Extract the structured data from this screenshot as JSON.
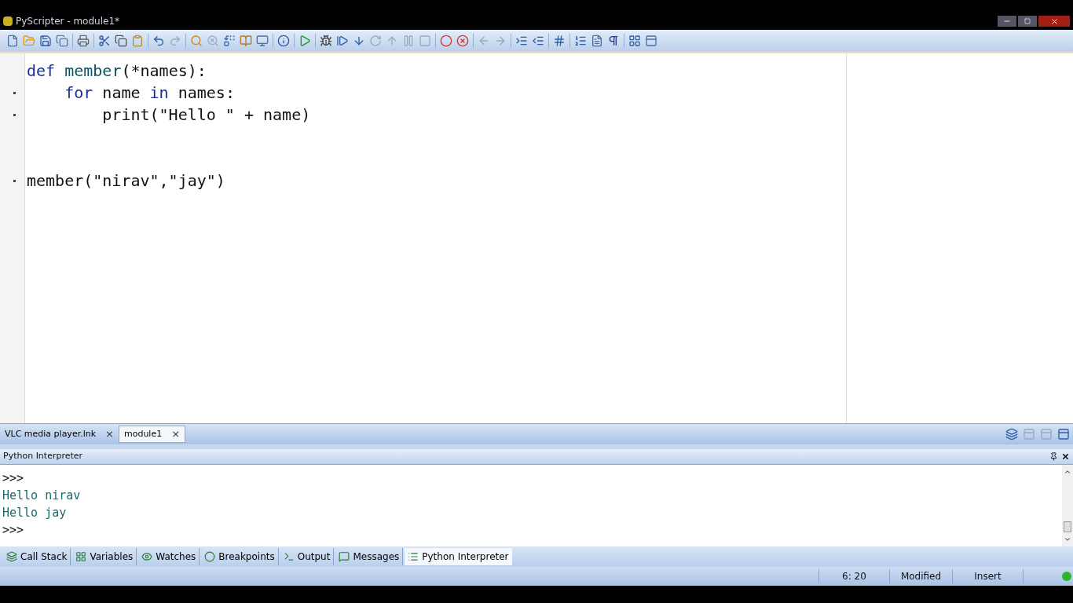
{
  "window": {
    "title": "PyScripter - module1*"
  },
  "editor": {
    "lines": [
      {
        "marker": false,
        "tokens": [
          {
            "kind": "keyword",
            "text": "def "
          },
          {
            "kind": "function",
            "text": "member"
          },
          {
            "kind": "plain",
            "text": "(*names):"
          }
        ]
      },
      {
        "marker": true,
        "tokens": [
          {
            "kind": "keyword",
            "text": "    for"
          },
          {
            "kind": "plain",
            "text": " name "
          },
          {
            "kind": "keyword",
            "text": "in"
          },
          {
            "kind": "plain",
            "text": " names:"
          }
        ]
      },
      {
        "marker": true,
        "tokens": [
          {
            "kind": "plain",
            "text": "        print(\"Hello \" + name)"
          }
        ]
      },
      {
        "marker": false
      },
      {
        "marker": false
      },
      {
        "marker": true,
        "tokens": [
          {
            "kind": "plain",
            "text": "member(\"nirav\",\"jay\")"
          }
        ]
      }
    ]
  },
  "doc_tabs": [
    {
      "label": "VLC media player.lnk",
      "selected": false,
      "close": "×"
    },
    {
      "label": "module1",
      "selected": true,
      "close": "×"
    }
  ],
  "interpreter": {
    "title": "Python Interpreter",
    "lines": [
      {
        "kind": "prompt",
        "text": ">>>"
      },
      {
        "kind": "output",
        "text": "Hello nirav"
      },
      {
        "kind": "output",
        "text": "Hello jay"
      },
      {
        "kind": "prompt",
        "text": ">>>"
      }
    ]
  },
  "bottom_tabs": [
    {
      "label": "Call Stack",
      "selected": false
    },
    {
      "label": "Variables",
      "selected": false
    },
    {
      "label": "Watches",
      "selected": false
    },
    {
      "label": "Breakpoints",
      "selected": false
    },
    {
      "label": "Output",
      "selected": false
    },
    {
      "label": "Messages",
      "selected": false
    },
    {
      "label": "Python Interpreter",
      "selected": true
    }
  ],
  "status_bar": {
    "position": "6: 20",
    "modified": "Modified",
    "mode": "Insert"
  }
}
